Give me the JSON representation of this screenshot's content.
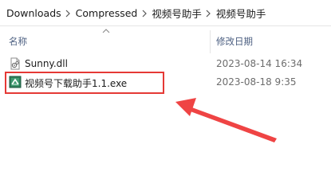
{
  "breadcrumb": {
    "items": [
      "Downloads",
      "Compressed",
      "视频号助手",
      "视频号助手"
    ]
  },
  "columns": {
    "name": "名称",
    "modified": "修改日期"
  },
  "files": [
    {
      "name": "Sunny.dll",
      "modified": "2023-08-14 16:34",
      "icon": "dll-file-icon"
    },
    {
      "name": "视频号下载助手1.1.exe",
      "modified": "2023-08-18 9:35",
      "icon": "exe-app-icon"
    }
  ],
  "annotation": {
    "highlight_color": "#e53935",
    "highlighted_file_index": 1
  }
}
